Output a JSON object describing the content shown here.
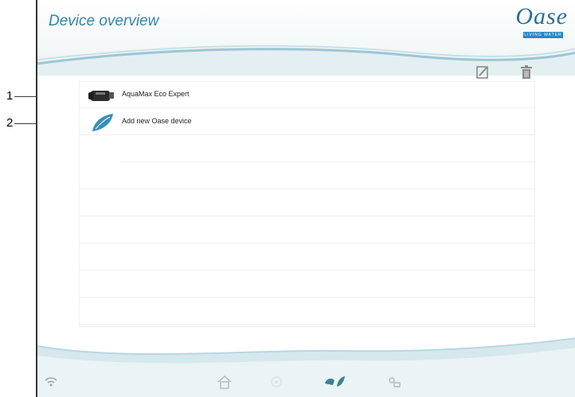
{
  "header": {
    "title": "Device overview"
  },
  "logo": {
    "brand": "Oase",
    "tagline": "LIVING WATER"
  },
  "toolbar": {
    "edit_icon": "edit-icon",
    "delete_icon": "trash-icon"
  },
  "devices": [
    {
      "label": "AquaMax Eco Expert",
      "icon": "pump-icon"
    },
    {
      "label": "Add new Oase device",
      "icon": "leaf-icon"
    }
  ],
  "callouts": {
    "first": "1",
    "second": "2"
  },
  "tabbar": {
    "items": [
      {
        "icon": "wifi-icon"
      },
      {
        "icon": "home-icon"
      },
      {
        "icon": "settings-icon"
      },
      {
        "icon": "devices-icon"
      },
      {
        "icon": "connect-icon"
      }
    ]
  },
  "colors": {
    "accent": "#2f86ab",
    "wave": "#cfe3e8",
    "icon_gray": "#9aa4a8"
  }
}
